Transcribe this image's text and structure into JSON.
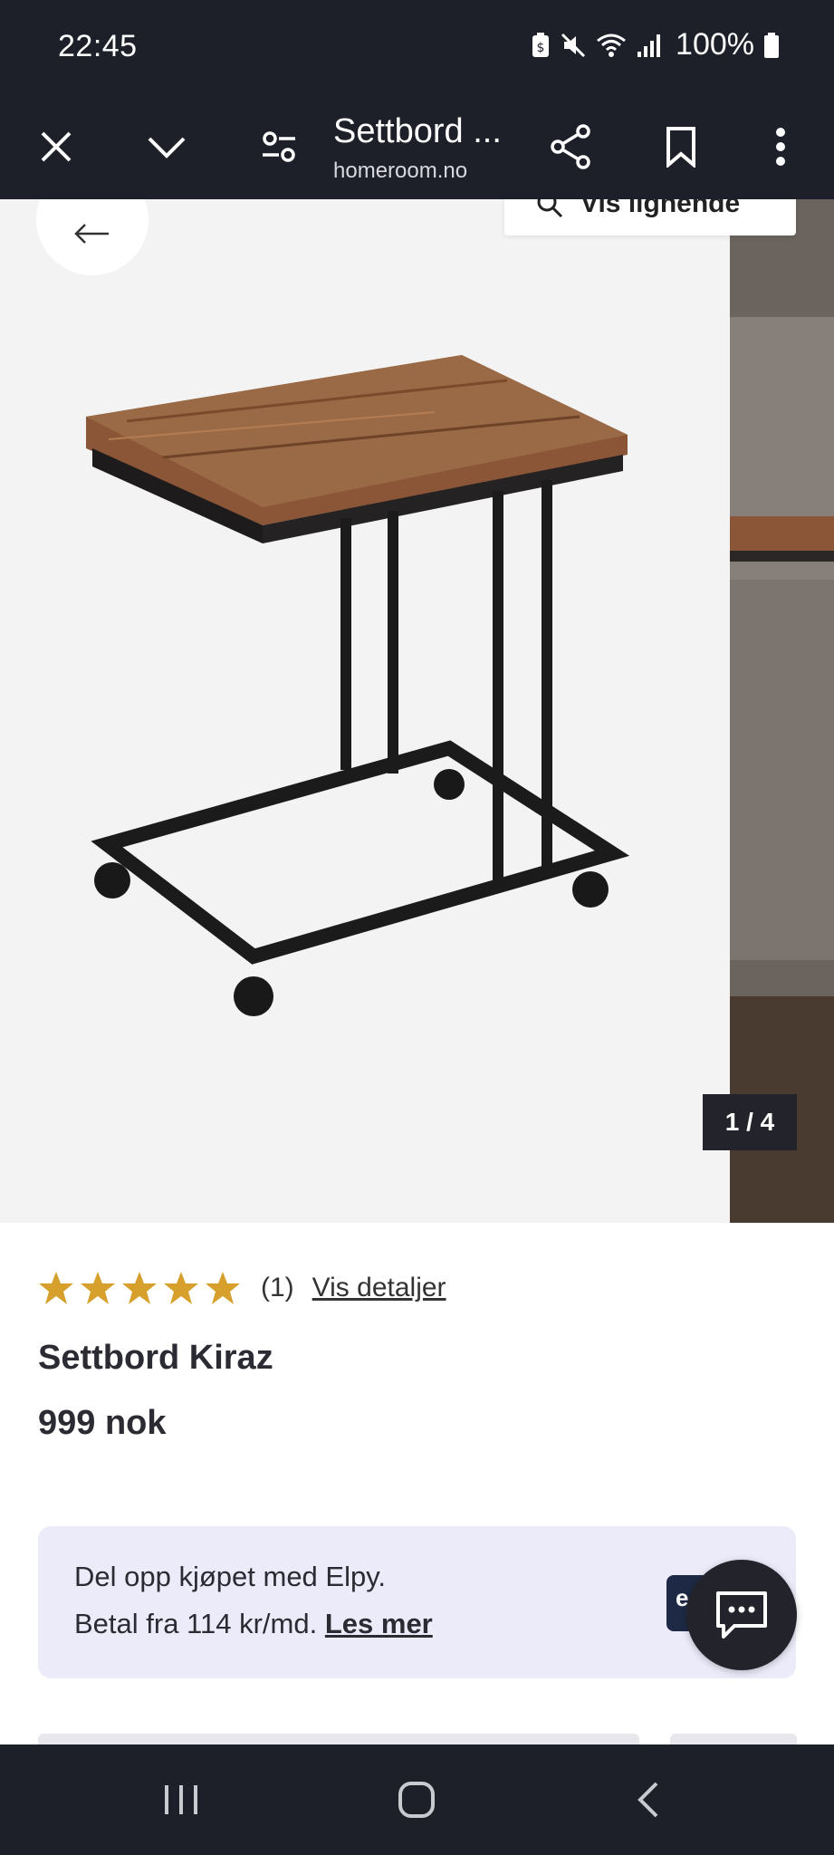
{
  "status_bar": {
    "time": "22:45",
    "battery": "100%"
  },
  "toolbar": {
    "title": "Settbord ...",
    "domain": "homeroom.no"
  },
  "gallery": {
    "similar_label": "Vis lignende",
    "counter": "1 / 4"
  },
  "product": {
    "rating": 5,
    "rating_count": "(1)",
    "details_link": "Vis detaljer",
    "name": "Settbord Kiraz",
    "price": "999 nok"
  },
  "elpy": {
    "line1": "Del opp kjøpet med Elpy.",
    "line2_prefix": "Betal fra 114 kr/md.",
    "link": "Les mer",
    "logo_letter": "e"
  },
  "colors": {
    "chrome_bg": "#1e2029",
    "star": "#d7a02c",
    "banner_bg": "#ecebfa"
  }
}
